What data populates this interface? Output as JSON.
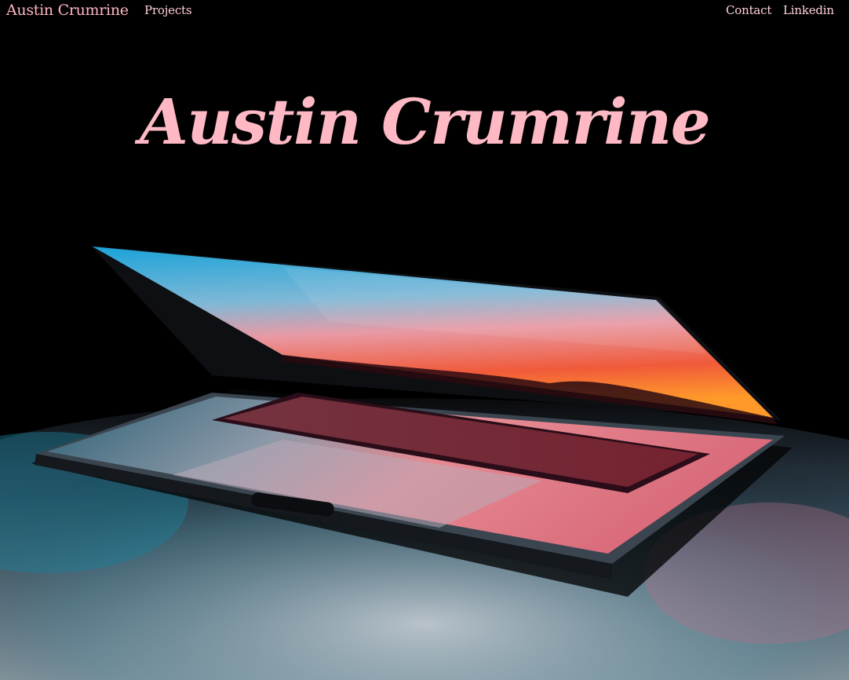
{
  "nav": {
    "brand": "Austin Crumrine",
    "projects": "Projects",
    "contact": "Contact",
    "linkedin": "Linkedin"
  },
  "hero": {
    "title": "Austin Crumrine"
  },
  "colors": {
    "accent": "#ffb6c1",
    "background": "#000000"
  }
}
